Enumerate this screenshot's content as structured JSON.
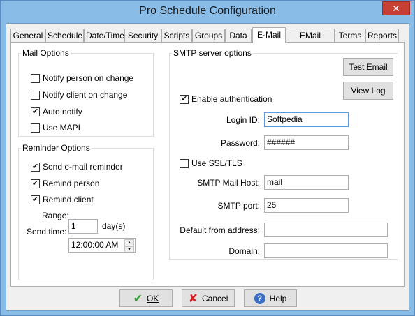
{
  "window": {
    "title": "Pro Schedule Configuration",
    "close_glyph": "✕"
  },
  "tabs": [
    "General",
    "Schedule",
    "Date/Time",
    "Security",
    "Scripts",
    "Groups",
    "Data",
    "E-Mail",
    "EMail Scripts",
    "Terms",
    "Reports"
  ],
  "active_tab": "E-Mail",
  "mail_options": {
    "title": "Mail Options",
    "items": [
      {
        "label": "Notify person on change",
        "checked": false
      },
      {
        "label": "Notify client on change",
        "checked": false
      },
      {
        "label": "Auto notify",
        "checked": true
      },
      {
        "label": "Use MAPI",
        "checked": false
      }
    ]
  },
  "reminder_options": {
    "title": "Reminder Options",
    "items": [
      {
        "label": "Send e-mail reminder",
        "checked": true
      },
      {
        "label": "Remind person",
        "checked": true
      },
      {
        "label": "Remind client",
        "checked": true
      }
    ],
    "range_label": "Range:",
    "range_value": "1",
    "range_unit": "day(s)",
    "send_time_label": "Send time:",
    "send_time_value": "12:00:00 AM"
  },
  "smtp": {
    "title": "SMTP server options",
    "test_email_label": "Test Email",
    "view_log_label": "View Log",
    "enable_auth": {
      "label": "Enable authentication",
      "checked": true
    },
    "login_id": {
      "label": "Login ID:",
      "value": "Softpedia"
    },
    "password": {
      "label": "Password:",
      "value": "######"
    },
    "use_ssl": {
      "label": "Use SSL/TLS",
      "checked": false
    },
    "host": {
      "label": "SMTP Mail Host:",
      "value": "mail"
    },
    "port": {
      "label": "SMTP port:",
      "value": "25"
    },
    "default_from": {
      "label": "Default from address:",
      "value": ""
    },
    "domain": {
      "label": "Domain:",
      "value": ""
    }
  },
  "buttons": {
    "ok": "OK",
    "cancel": "Cancel",
    "help": "Help"
  },
  "colors": {
    "window_frame": "#89bde8",
    "close": "#c84034",
    "ok_icon": "#2f9a2f",
    "cancel_icon": "#d02020",
    "help_icon": "#3a6fc4"
  }
}
